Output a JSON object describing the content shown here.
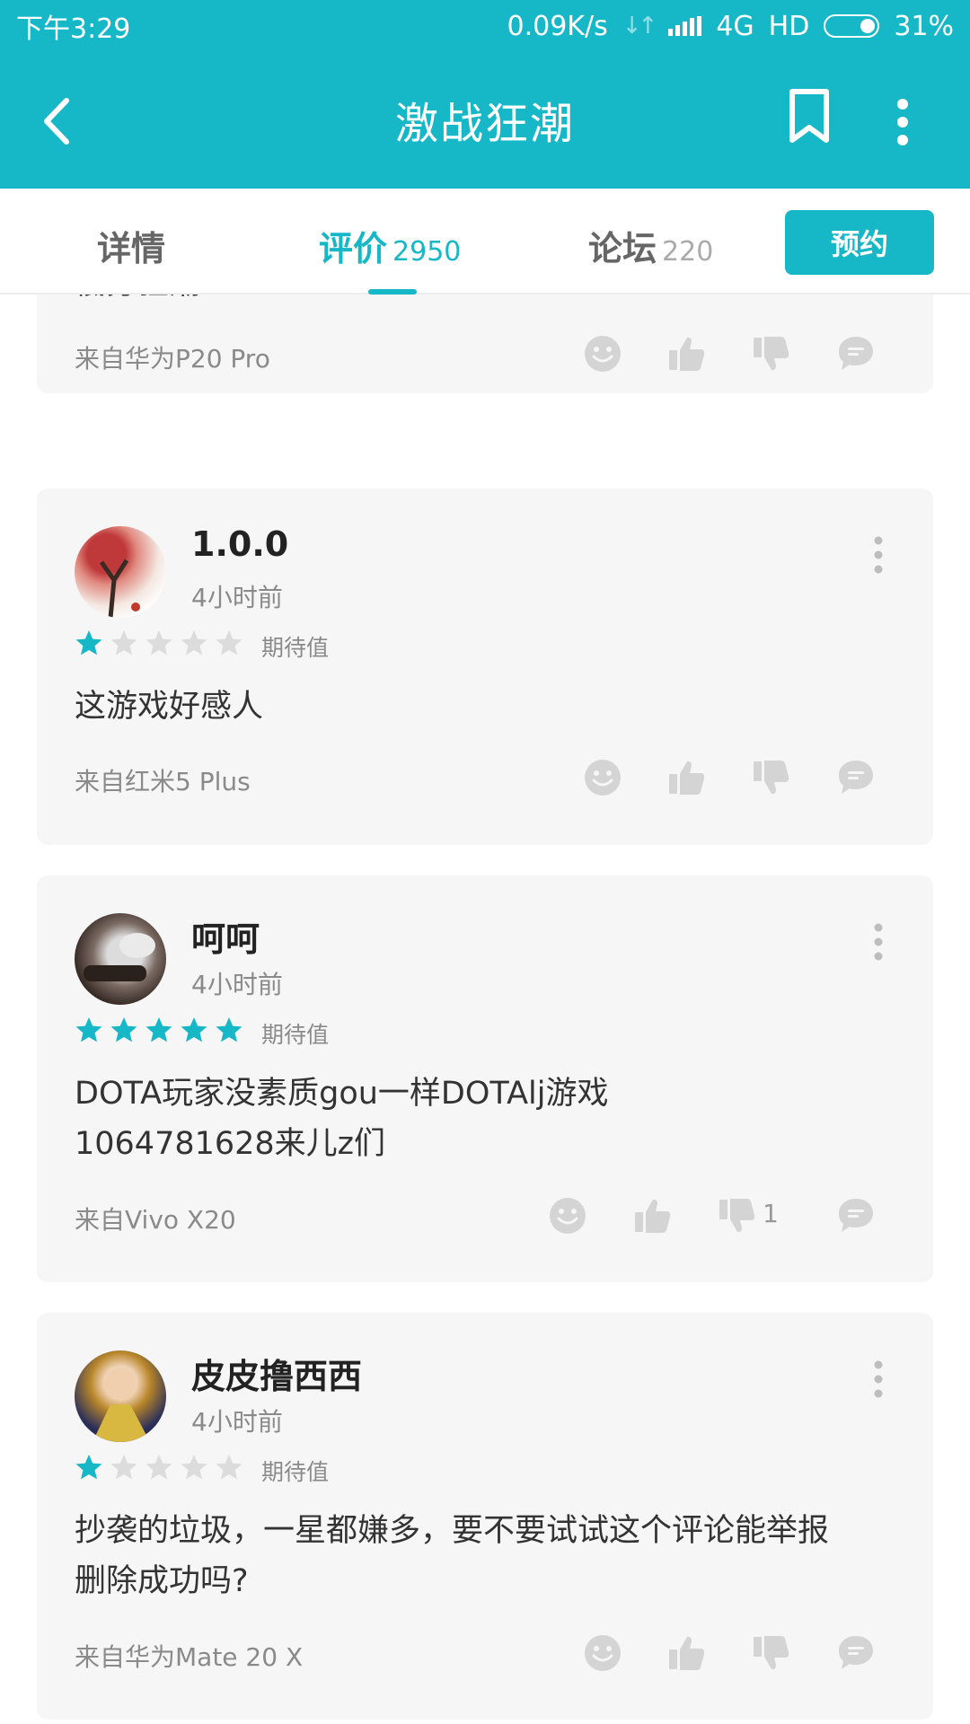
{
  "status_bar": {
    "time": "下午3:29",
    "speed": "0.09K/s",
    "network": "4G",
    "hd": "HD",
    "battery": "31%"
  },
  "app_bar": {
    "title": "激战狂潮",
    "icons": [
      "back-arrow-icon",
      "bookmark-icon",
      "more-vertical-icon"
    ]
  },
  "tabs": {
    "items": [
      {
        "label": "详情",
        "count": ""
      },
      {
        "label": "评价",
        "count": "2950"
      },
      {
        "label": "论坛",
        "count": "220"
      }
    ],
    "active_index": 1,
    "reserve_label": "预约"
  },
  "colors": {
    "accent": "#16b8c7",
    "star_off": "#dcdcdc",
    "card_bg": "#f6f6f6",
    "icon_gray": "#d4d4d4"
  },
  "reviews": [
    {
      "content": "低分狂潮",
      "device": "来自华为P20 Pro"
    },
    {
      "username": "1.0.0",
      "time": "4小时前",
      "rating": 1,
      "rating_label": "期待值",
      "content": "这游戏好感人",
      "device": "来自红米5 Plus"
    },
    {
      "username": "呵呵",
      "time": "4小时前",
      "rating": 5,
      "rating_label": "期待值",
      "content_line1": "DOTA玩家没素质gou一样DOTAlj游戏",
      "content_line2": "1064781628来儿z们",
      "device": "来自Vivo X20",
      "dislike_count": "1"
    },
    {
      "username": "皮皮撸西西",
      "time": "4小时前",
      "rating": 1,
      "rating_label": "期待值",
      "content_line1": "抄袭的垃圾，一星都嫌多，要不要试试这个评论能举报",
      "content_line2": "删除成功吗?",
      "device": "来自华为Mate 20 X"
    }
  ]
}
